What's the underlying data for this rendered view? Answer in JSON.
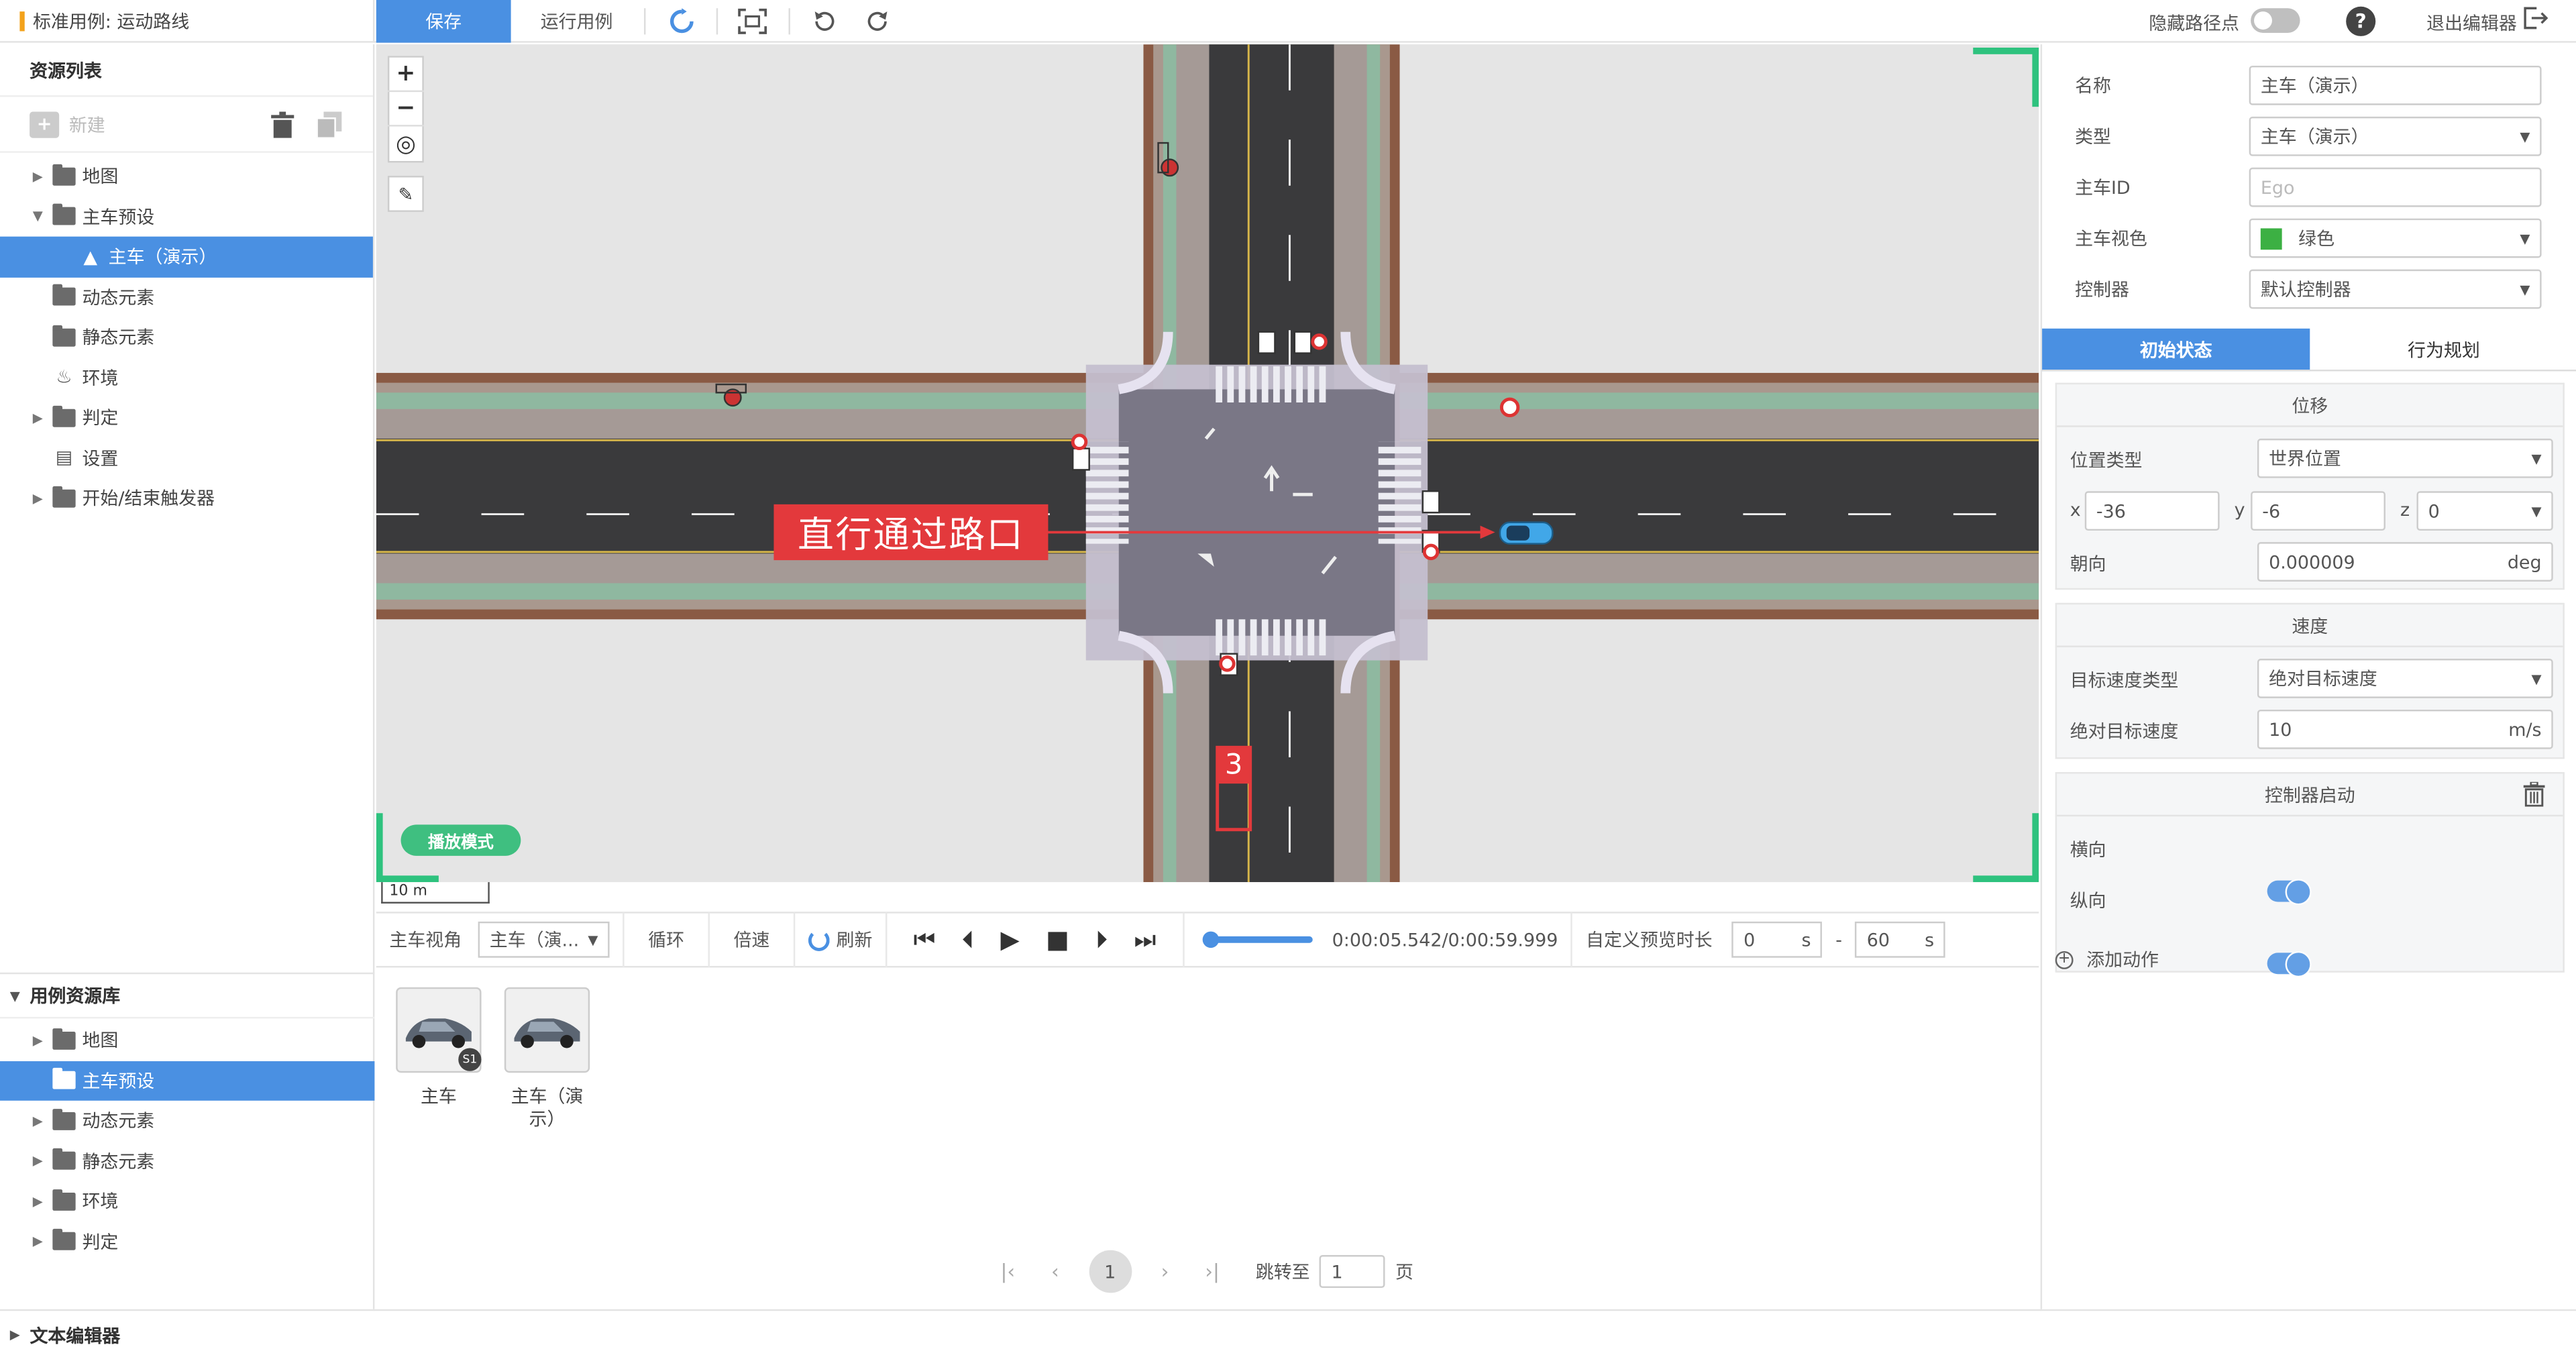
{
  "app": {
    "title": "标准用例: 运动路线"
  },
  "toolbar": {
    "save_label": "保存",
    "run_label": "运行用例",
    "hide_waypoints_label": "隐藏路径点",
    "exit_label": "退出编辑器"
  },
  "left_panel": {
    "title": "资源列表",
    "new_label": "新建",
    "tree": [
      {
        "label": "地图",
        "type": "folder",
        "level": 1,
        "arrow": "▶",
        "selected": false
      },
      {
        "label": "主车预设",
        "type": "folder-open",
        "level": 1,
        "arrow": "▼",
        "selected": false
      },
      {
        "label": "主车（演示）",
        "type": "car",
        "level": 2,
        "arrow": "",
        "selected": true
      },
      {
        "label": "动态元素",
        "type": "folder",
        "level": 1,
        "arrow": "",
        "selected": false
      },
      {
        "label": "静态元素",
        "type": "folder",
        "level": 1,
        "arrow": "",
        "selected": false
      },
      {
        "label": "环境",
        "type": "env",
        "level": 1,
        "arrow": "",
        "selected": false
      },
      {
        "label": "判定",
        "type": "folder",
        "level": 1,
        "arrow": "▶",
        "selected": false
      },
      {
        "label": "设置",
        "type": "settings",
        "level": 1,
        "arrow": "",
        "selected": false
      },
      {
        "label": "开始/结束触发器",
        "type": "folder",
        "level": 1,
        "arrow": "▶",
        "selected": false
      }
    ],
    "library_title": "用例资源库",
    "library": [
      {
        "label": "地图",
        "arrow": "▶",
        "selected": false
      },
      {
        "label": "主车预设",
        "arrow": "",
        "selected": true
      },
      {
        "label": "动态元素",
        "arrow": "▶",
        "selected": false
      },
      {
        "label": "静态元素",
        "arrow": "▶",
        "selected": false
      },
      {
        "label": "环境",
        "arrow": "▶",
        "selected": false
      },
      {
        "label": "判定",
        "arrow": "▶",
        "selected": false
      }
    ]
  },
  "canvas": {
    "route_label": "直行通过路口",
    "waypoint_number": "3",
    "play_mode_label": "播放模式",
    "scale_label": "10 m"
  },
  "playbar": {
    "view_label": "主车视角",
    "view_value": "主车（演...",
    "loop_label": "循环",
    "speed_label": "倍速",
    "refresh_label": "刷新",
    "time": "0:00:05.542/0:00:59.999",
    "progress": 0.092,
    "custom_label": "自定义预览时长",
    "start_value": "0",
    "end_value": "60",
    "unit": "s",
    "dash": "-"
  },
  "assets": [
    {
      "label": "主车",
      "badge": "S1"
    },
    {
      "label": "主车（演示）",
      "badge": ""
    }
  ],
  "pagination": {
    "current": "1",
    "jump_label": "跳转至",
    "jump_value": "1",
    "page_suffix": "页"
  },
  "footer": {
    "label": "文本编辑器"
  },
  "props": {
    "name_label": "名称",
    "name_value": "主车（演示）",
    "type_label": "类型",
    "type_value": "主车（演示）",
    "id_label": "主车ID",
    "id_placeholder": "Ego",
    "color_label": "主车视色",
    "color_value": "绿色",
    "color_swatch": "#3cb043",
    "controller_label": "控制器",
    "controller_value": "默认控制器",
    "tab_initial": "初始状态",
    "tab_behavior": "行为规划",
    "position": {
      "title": "位移",
      "pos_type_label": "位置类型",
      "pos_type_value": "世界位置",
      "x_label": "x",
      "x_value": "-36",
      "y_label": "y",
      "y_value": "-6",
      "z_label": "z",
      "z_value": "0",
      "heading_label": "朝向",
      "heading_value": "0.000009",
      "heading_unit": "deg"
    },
    "speed": {
      "title": "速度",
      "target_type_label": "目标速度类型",
      "target_type_value": "绝对目标速度",
      "abs_label": "绝对目标速度",
      "abs_value": "10",
      "abs_unit": "m/s"
    },
    "controller_start": {
      "title": "控制器启动",
      "lateral_label": "横向",
      "lateral_on": true,
      "longitudinal_label": "纵向",
      "longitudinal_on": true
    },
    "add_action_label": "添加动作"
  },
  "colors": {
    "accent": "#4a90e2",
    "green": "#2ec27e",
    "route_red": "#e3393c"
  }
}
